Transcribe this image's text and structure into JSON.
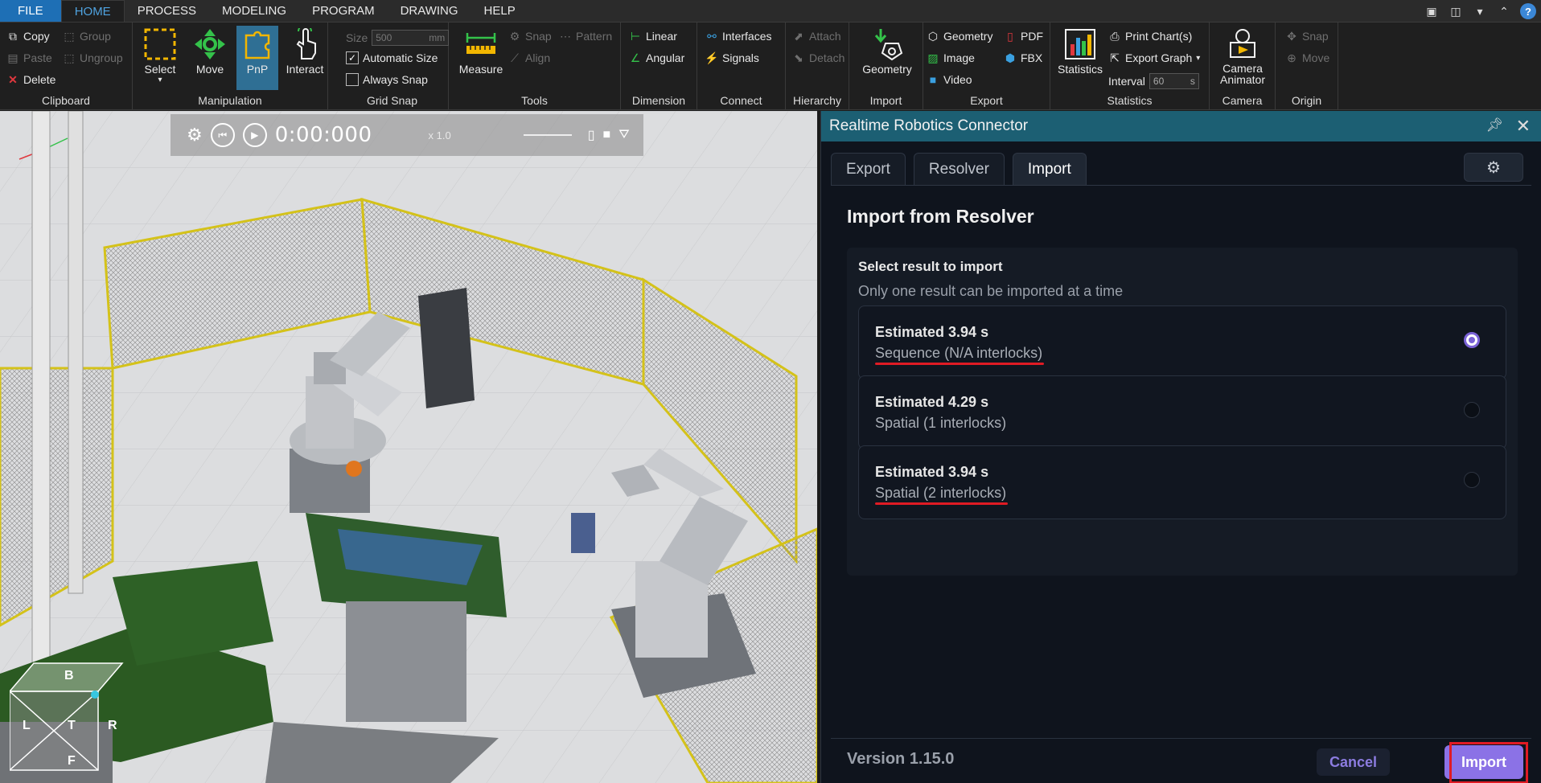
{
  "menu": {
    "tabs": [
      "FILE",
      "HOME",
      "PROCESS",
      "MODELING",
      "PROGRAM",
      "DRAWING",
      "HELP"
    ],
    "active": "HOME",
    "help_label": "?"
  },
  "ribbon": {
    "clipboard": {
      "copy": "Copy",
      "paste": "Paste",
      "delete": "Delete",
      "group": "Group",
      "ungroup": "Ungroup",
      "label": "Clipboard"
    },
    "manipulation": {
      "select": "Select",
      "move": "Move",
      "pnp": "PnP",
      "interact": "Interact",
      "label": "Manipulation"
    },
    "grid_snap": {
      "size_label": "Size",
      "size_value": "500",
      "size_unit": "mm",
      "automatic_size": "Automatic Size",
      "always_snap": "Always Snap",
      "label": "Grid Snap"
    },
    "tools": {
      "measure": "Measure",
      "snap": "Snap",
      "pattern": "Pattern",
      "align": "Align",
      "label": "Tools"
    },
    "dimension": {
      "linear": "Linear",
      "angular": "Angular",
      "label": "Dimension"
    },
    "connect": {
      "interfaces": "Interfaces",
      "signals": "Signals",
      "label": "Connect"
    },
    "hierarchy": {
      "attach": "Attach",
      "detach": "Detach",
      "label": "Hierarchy"
    },
    "import": {
      "geometry": "Geometry",
      "label": "Import"
    },
    "export": {
      "geometry": "Geometry",
      "image": "Image",
      "video": "Video",
      "pdf": "PDF",
      "fbx": "FBX",
      "label": "Export"
    },
    "statistics": {
      "statistics": "Statistics",
      "print_charts": "Print Chart(s)",
      "export_graph": "Export Graph",
      "interval_label": "Interval",
      "interval_value": "60",
      "interval_unit": "s",
      "label": "Statistics"
    },
    "camera": {
      "camera_animator_1": "Camera",
      "camera_animator_2": "Animator",
      "label": "Camera"
    },
    "origin": {
      "snap": "Snap",
      "move": "Move",
      "label": "Origin"
    }
  },
  "viewport": {
    "time": "0:00:000",
    "speed": "x 1.0",
    "cube": {
      "top": "B",
      "left": "L",
      "center": "T",
      "right": "R",
      "bottom": "F"
    }
  },
  "dialog": {
    "title": "Realtime Robotics Connector",
    "tabs": [
      {
        "label": "Export",
        "selected": false
      },
      {
        "label": "Resolver",
        "selected": false
      },
      {
        "label": "Import",
        "selected": true
      }
    ],
    "heading": "Import from Resolver",
    "select_title": "Select result to import",
    "select_subtitle": "Only one result can be imported at a time",
    "results": [
      {
        "estimate": "Estimated 3.94 s",
        "type": "Sequence (N/A interlocks)",
        "selected": true,
        "underlined": true
      },
      {
        "estimate": "Estimated 4.29 s",
        "type": "Spatial (1 interlocks)",
        "selected": false,
        "underlined": false
      },
      {
        "estimate": "Estimated 3.94 s",
        "type": "Spatial (2 interlocks)",
        "selected": false,
        "underlined": true
      }
    ],
    "version": "Version 1.15.0",
    "cancel_label": "Cancel",
    "import_label": "Import"
  },
  "colors": {
    "accent": "#8b72e6",
    "title_bar": "#1c5f73",
    "highlight": "#e01b24",
    "file_tab": "#1e6fb5"
  }
}
